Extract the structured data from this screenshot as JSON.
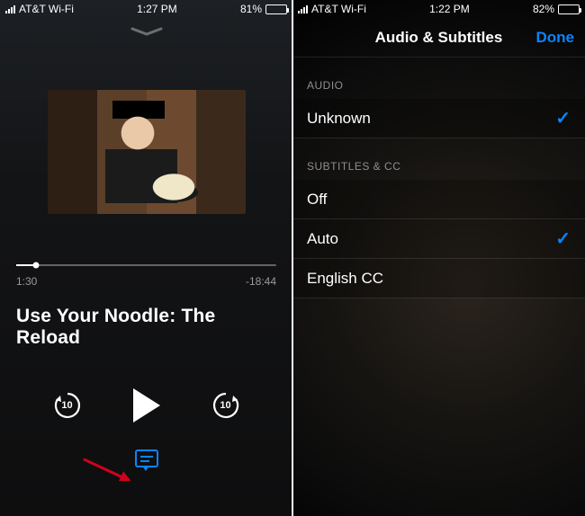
{
  "left": {
    "status": {
      "carrier": "AT&T Wi-Fi",
      "time": "1:27 PM",
      "battery_pct": "81%"
    },
    "player": {
      "elapsed": "1:30",
      "remaining": "-18:44",
      "title": "Use Your Noodle: The Reload",
      "skip_back_seconds": "10",
      "skip_fwd_seconds": "10"
    }
  },
  "right": {
    "status": {
      "carrier": "AT&T Wi-Fi",
      "time": "1:22 PM",
      "battery_pct": "82%"
    },
    "nav": {
      "title": "Audio & Subtitles",
      "done": "Done"
    },
    "audio": {
      "header": "Audio",
      "options": [
        {
          "label": "Unknown",
          "selected": true
        }
      ]
    },
    "subtitles": {
      "header": "Subtitles & CC",
      "options": [
        {
          "label": "Off",
          "selected": false
        },
        {
          "label": "Auto",
          "selected": true
        },
        {
          "label": "English CC",
          "selected": false
        }
      ]
    }
  },
  "colors": {
    "accent": "#0a84ff",
    "arrow": "#d0021b"
  }
}
